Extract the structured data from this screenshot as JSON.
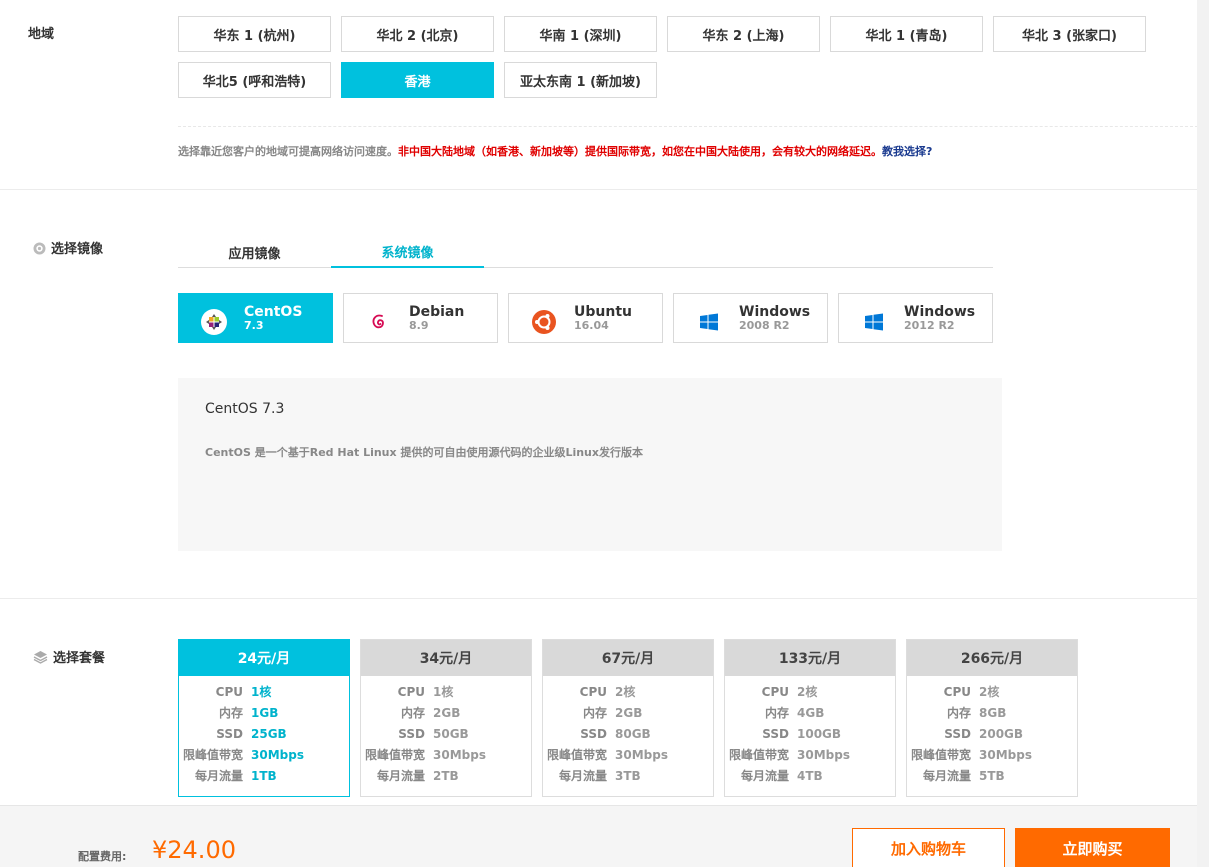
{
  "region": {
    "label": "地域",
    "options": [
      "华东 1 (杭州)",
      "华北 2 (北京)",
      "华南 1 (深圳)",
      "华东 2 (上海)",
      "华北 1 (青岛)",
      "华北 3 (张家口)",
      "华北5 (呼和浩特)",
      "香港",
      "亚太东南 1 (新加坡)"
    ],
    "selected": "香港",
    "notice_gray": "选择靠近您客户的地域可提高网络访问速度。",
    "notice_red": "非中国大陆地域（如香港、新加坡等）提供国际带宽，如您在中国大陆使用，会有较大的网络延迟。",
    "notice_link": "教我选择?"
  },
  "image": {
    "label": "选择镜像",
    "tabs": [
      "应用镜像",
      "系统镜像"
    ],
    "active_tab": "系统镜像",
    "os": [
      {
        "name": "CentOS",
        "version": "7.3",
        "icon": "centos-icon"
      },
      {
        "name": "Debian",
        "version": "8.9",
        "icon": "debian-icon"
      },
      {
        "name": "Ubuntu",
        "version": "16.04",
        "icon": "ubuntu-icon"
      },
      {
        "name": "Windows",
        "version": "2008 R2",
        "icon": "windows-icon"
      },
      {
        "name": "Windows",
        "version": "2012 R2",
        "icon": "windows-icon"
      }
    ],
    "selected_os": "CentOS",
    "desc_title": "CentOS 7.3",
    "desc_text": "CentOS 是一个基于Red Hat Linux 提供的可自由使用源代码的企业级Linux发行版本"
  },
  "plan": {
    "label": "选择套餐",
    "keys": [
      "CPU",
      "内存",
      "SSD",
      "限峰值带宽",
      "每月流量"
    ],
    "plans": [
      {
        "price": "24元/月",
        "values": [
          "1核",
          "1GB",
          "25GB",
          "30Mbps",
          "1TB"
        ]
      },
      {
        "price": "34元/月",
        "values": [
          "1核",
          "2GB",
          "50GB",
          "30Mbps",
          "2TB"
        ]
      },
      {
        "price": "67元/月",
        "values": [
          "2核",
          "2GB",
          "80GB",
          "30Mbps",
          "3TB"
        ]
      },
      {
        "price": "133元/月",
        "values": [
          "2核",
          "4GB",
          "100GB",
          "30Mbps",
          "4TB"
        ]
      },
      {
        "price": "266元/月",
        "values": [
          "2核",
          "8GB",
          "200GB",
          "30Mbps",
          "5TB"
        ]
      }
    ],
    "selected": "24元/月"
  },
  "footer": {
    "fee_label": "配置费用:",
    "fee_value": "¥24.00",
    "add_cart": "加入购物车",
    "buy_now": "立即购买"
  },
  "colors": {
    "accent": "#00c1de",
    "orange": "#ff6a00",
    "red": "#e00000",
    "link": "#1a3a8f"
  }
}
